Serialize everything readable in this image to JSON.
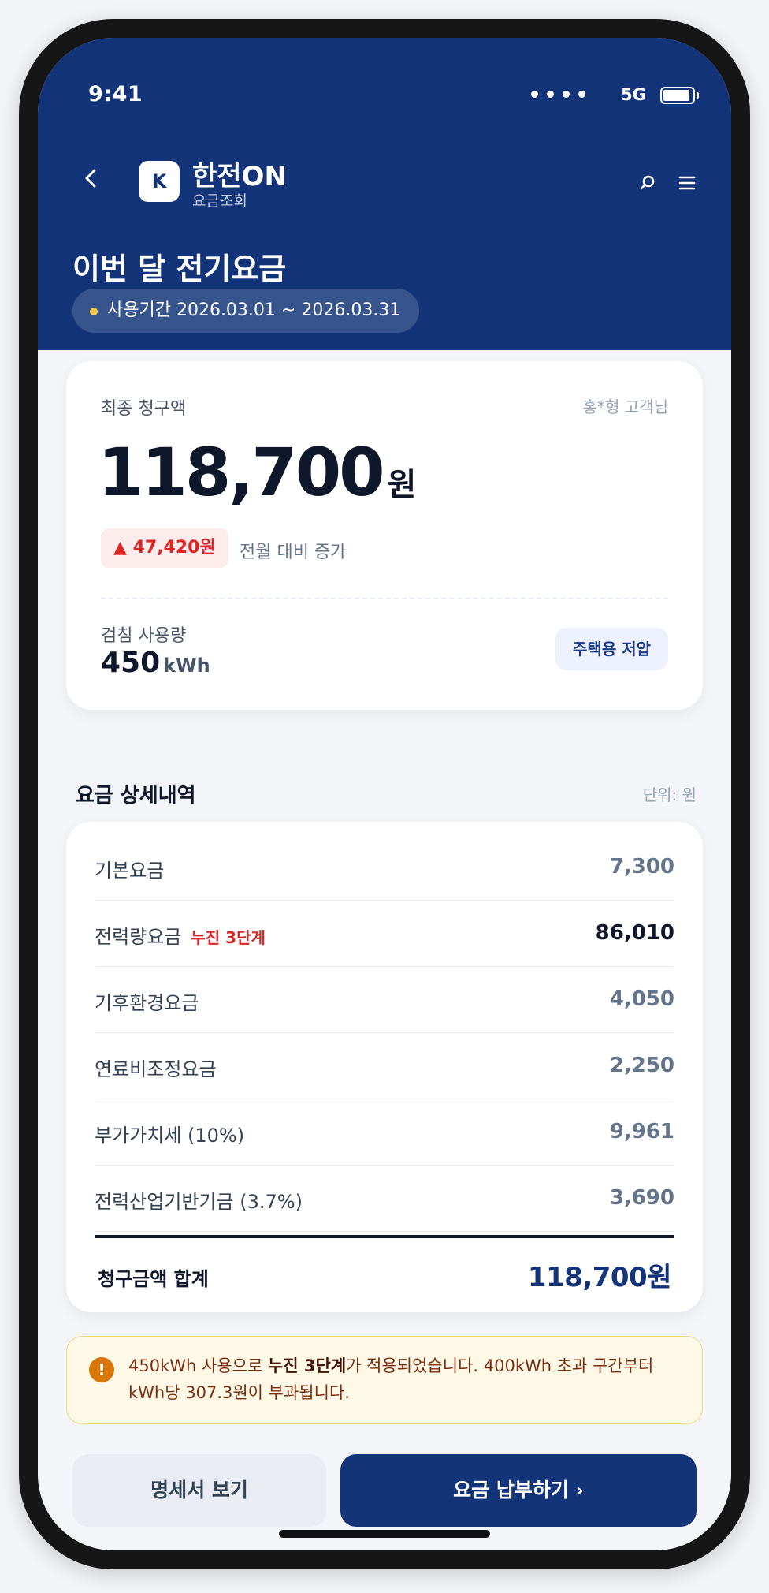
{
  "status_bar": {
    "time": "9:41",
    "network": "5G"
  },
  "header": {
    "logo_letter": "K",
    "app_title": "한전ON",
    "app_subtitle": "요금조회",
    "page_title": "이번 달 전기요금",
    "period": "사용기간 2026.03.01 ~ 2026.03.31"
  },
  "bill": {
    "label": "최종 청구액",
    "customer": "홍*형 고객님",
    "amount": "118,700",
    "unit": "원",
    "increase": "▲ 47,420원",
    "increase_caption": "전월 대비 증가",
    "usage_label": "검침 사용량",
    "usage_value": "450",
    "usage_unit": "kWh",
    "plan": "주택용 저압"
  },
  "details": {
    "title": "요금 상세내역",
    "unit_note": "단위: 원",
    "rows": [
      {
        "label": "기본요금",
        "value": "7,300"
      },
      {
        "label": "전력량요금",
        "tier": "누진 3단계",
        "value": "86,010"
      },
      {
        "label": "기후환경요금",
        "value": "4,050"
      },
      {
        "label": "연료비조정요금",
        "value": "2,250"
      },
      {
        "label": "부가가치세 (10%)",
        "value": "9,961"
      },
      {
        "label": "전력산업기반기금 (3.7%)",
        "value": "3,690"
      }
    ],
    "total_label": "청구금액 합계",
    "total_value": "118,700원"
  },
  "notice": {
    "text_before": "450kWh 사용으로 ",
    "text_bold": "누진 3단계",
    "text_after": "가 적용되었습니다. 400kWh 초과 구간부터 kWh당 307.3원이 부과됩니다."
  },
  "actions": {
    "statement_label": "명세서 보기",
    "pay_label": "요금 납부하기 ›"
  },
  "colors": {
    "primary": "#133478",
    "danger": "#dc2626",
    "warning": "#d97706"
  }
}
